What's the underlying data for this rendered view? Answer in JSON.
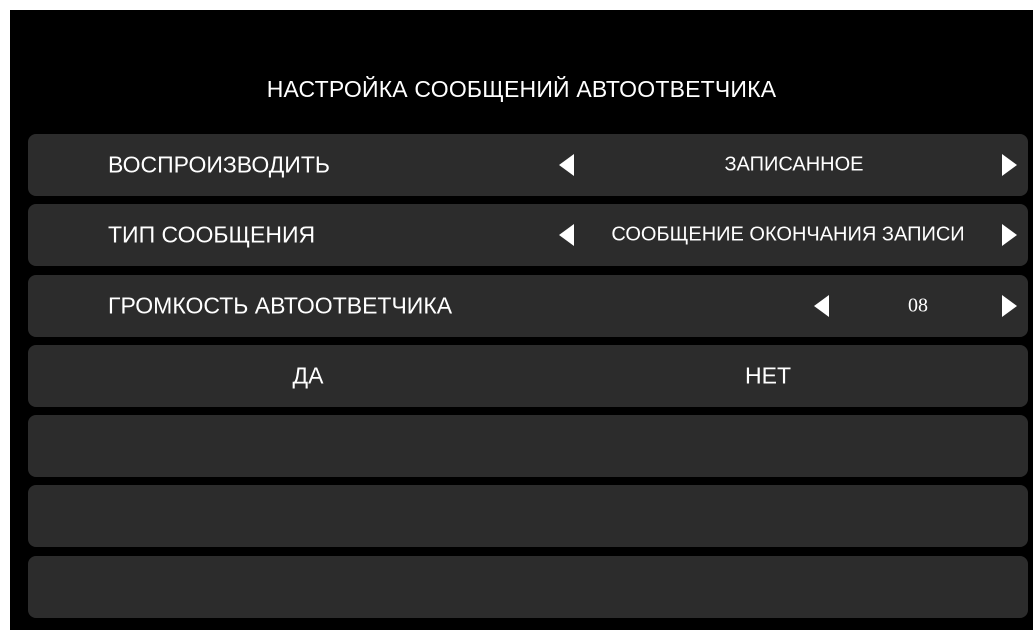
{
  "screen": {
    "title": "НАСТРОЙКА СООБЩЕНИЙ АВТООТВЕТЧИКА"
  },
  "settings": {
    "playback": {
      "label": "ВОСПРОИЗВОДИТЬ",
      "value": "ЗАПИСАННОЕ"
    },
    "message_type": {
      "label": "ТИП СООБЩЕНИЯ",
      "value": "СООБЩЕНИЕ ОКОНЧАНИЯ ЗАПИСИ"
    },
    "volume": {
      "label": "ГРОМКОСТЬ АВТООТВЕТЧИКА",
      "value": "08"
    }
  },
  "actions": {
    "yes_label": "ДА",
    "no_label": "НЕТ"
  },
  "icons": {
    "prev": "triangle-left-icon",
    "next": "triangle-right-icon"
  },
  "colors": {
    "background": "#000000",
    "row": "#2c2c2c",
    "text": "#ffffff"
  }
}
